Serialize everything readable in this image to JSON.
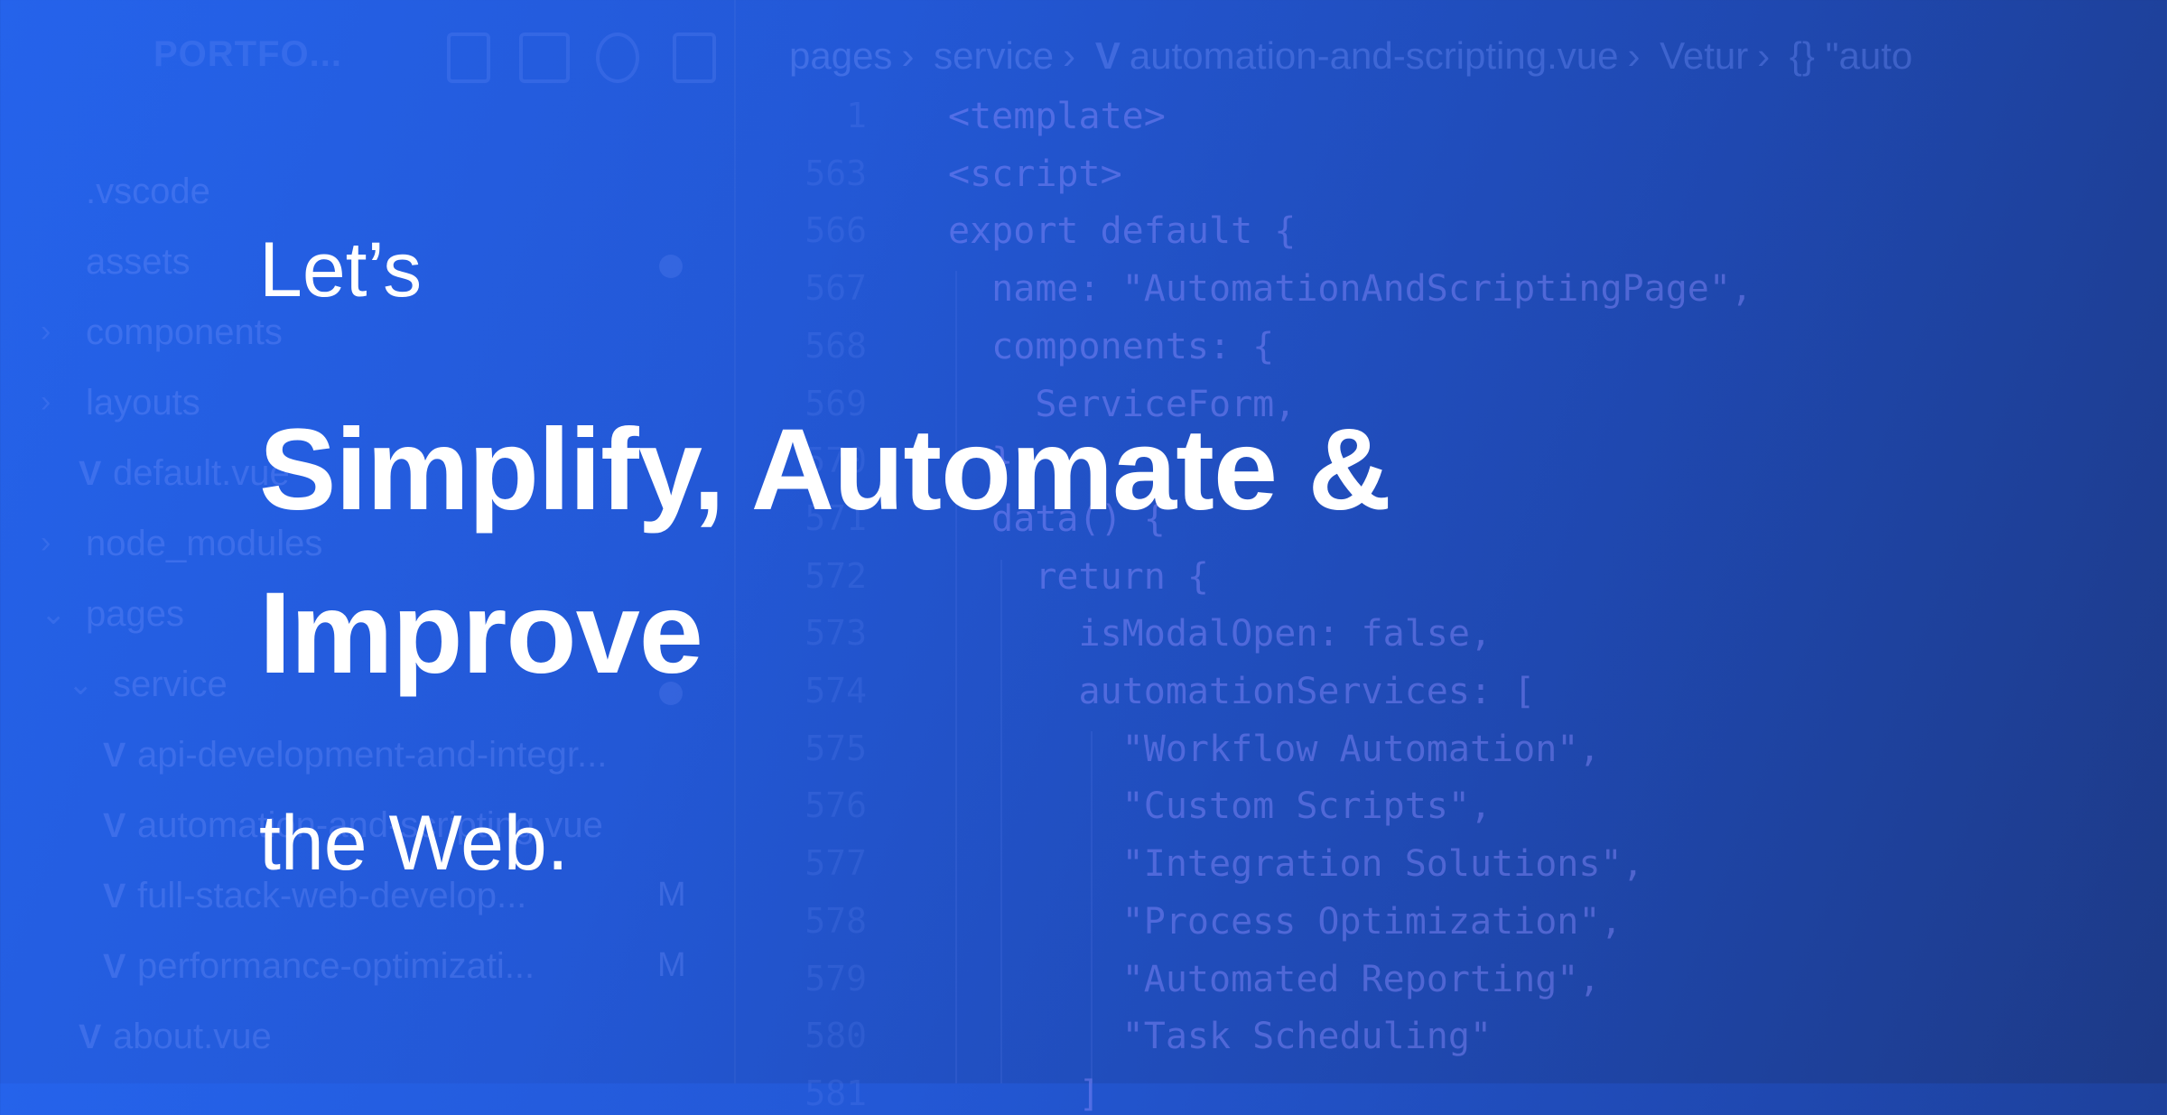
{
  "hero": {
    "line1": "Let’s",
    "line2": "Simplify, Automate &",
    "line3": "Improve",
    "line4": "the Web."
  },
  "explorer": {
    "title": "PORTFO...",
    "toolbar_icons": [
      "new-file-icon",
      "new-folder-icon",
      "refresh-icon",
      "collapse-all-icon"
    ],
    "items": [
      {
        "label": ".vscode"
      },
      {
        "label": "assets"
      },
      {
        "label": "components"
      },
      {
        "label": "layouts"
      },
      {
        "label": "default.vue"
      },
      {
        "label": "node_modules"
      },
      {
        "label": "pages"
      },
      {
        "label": "service"
      },
      {
        "label": "api-development-and-integr..."
      },
      {
        "label": "automation-and-scripting.vue"
      },
      {
        "label": "full-stack-web-develop...",
        "status": "M"
      },
      {
        "label": "performance-optimizati...",
        "status": "M"
      },
      {
        "label": "about.vue"
      }
    ]
  },
  "breadcrumb": [
    "pages",
    "service",
    "automation-and-scripting.vue",
    "Vetur",
    "{} \"auto"
  ],
  "code": {
    "line_numbers": [
      "1",
      "563",
      "566",
      "567",
      "568",
      "569",
      "570",
      "571",
      "572",
      "573",
      "574",
      "575",
      "576",
      "577",
      "578",
      "579",
      "580",
      "581"
    ],
    "lines": [
      "<template>",
      "<script>",
      "export default {",
      "  name: \"AutomationAndScriptingPage\",",
      "  components: {",
      "    ServiceForm,",
      "  },",
      "  data() {",
      "    return {",
      "      isModalOpen: false,",
      "      automationServices: [",
      "        \"Workflow Automation\",",
      "        \"Custom Scripts\",",
      "        \"Integration Solutions\",",
      "        \"Process Optimization\",",
      "        \"Automated Reporting\",",
      "        \"Task Scheduling\"",
      "      ]"
    ]
  },
  "colors": {
    "bg_start": "#2563eb",
    "bg_end": "#1d3a87",
    "text": "#ffffff"
  }
}
